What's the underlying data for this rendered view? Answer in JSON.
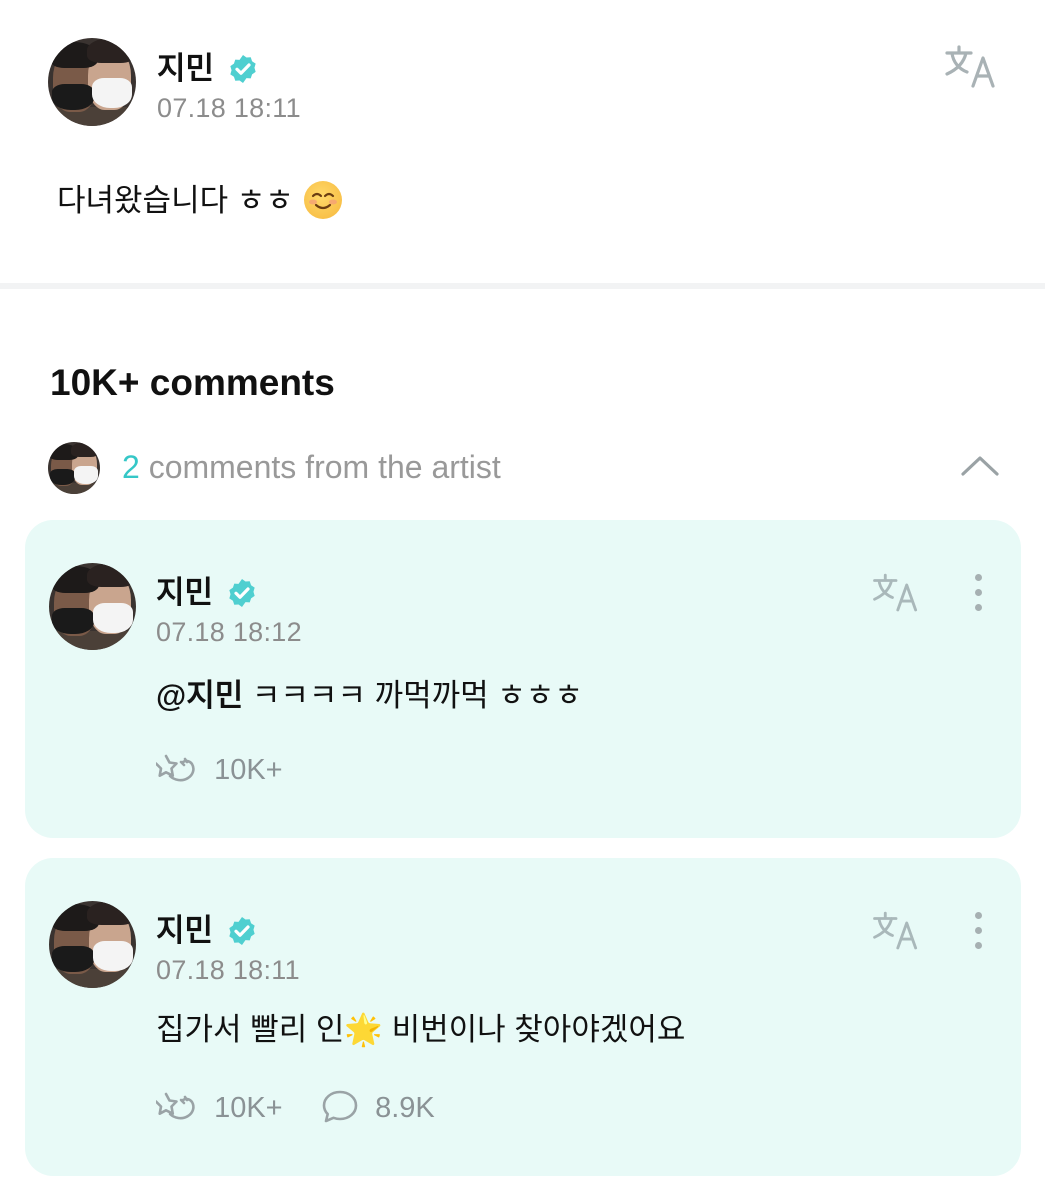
{
  "post": {
    "author": "지민",
    "timestamp": "07.18 18:11",
    "text": "다녀왔습니다 ㅎㅎ",
    "emoji": "☺️"
  },
  "comments_header": "10K+ comments",
  "artist_comments": {
    "count": "2",
    "label": " comments from the artist"
  },
  "comments": [
    {
      "author": "지민",
      "timestamp": "07.18 18:12",
      "mention": "@지민",
      "text": " ㅋㅋㅋㅋ 까먹까먹 ㅎㅎㅎ",
      "likes": "10K+"
    },
    {
      "author": "지민",
      "timestamp": "07.18 18:11",
      "text_before": "집가서 빨리 인",
      "text_emoji": "🌟",
      "text_after": " 비번이나 찾아야겠어요",
      "likes": "10K+",
      "replies": "8.9K"
    }
  ],
  "icons": {
    "verified": "verified-badge-icon",
    "translate": "translate-icon",
    "more": "more-vertical-icon",
    "chevron": "chevron-up-icon",
    "like": "cheer-icon",
    "reply": "comment-bubble-icon"
  },
  "colors": {
    "accent": "#35c7c7",
    "card_bg": "#e8faf7",
    "muted": "#8c8c8c"
  }
}
